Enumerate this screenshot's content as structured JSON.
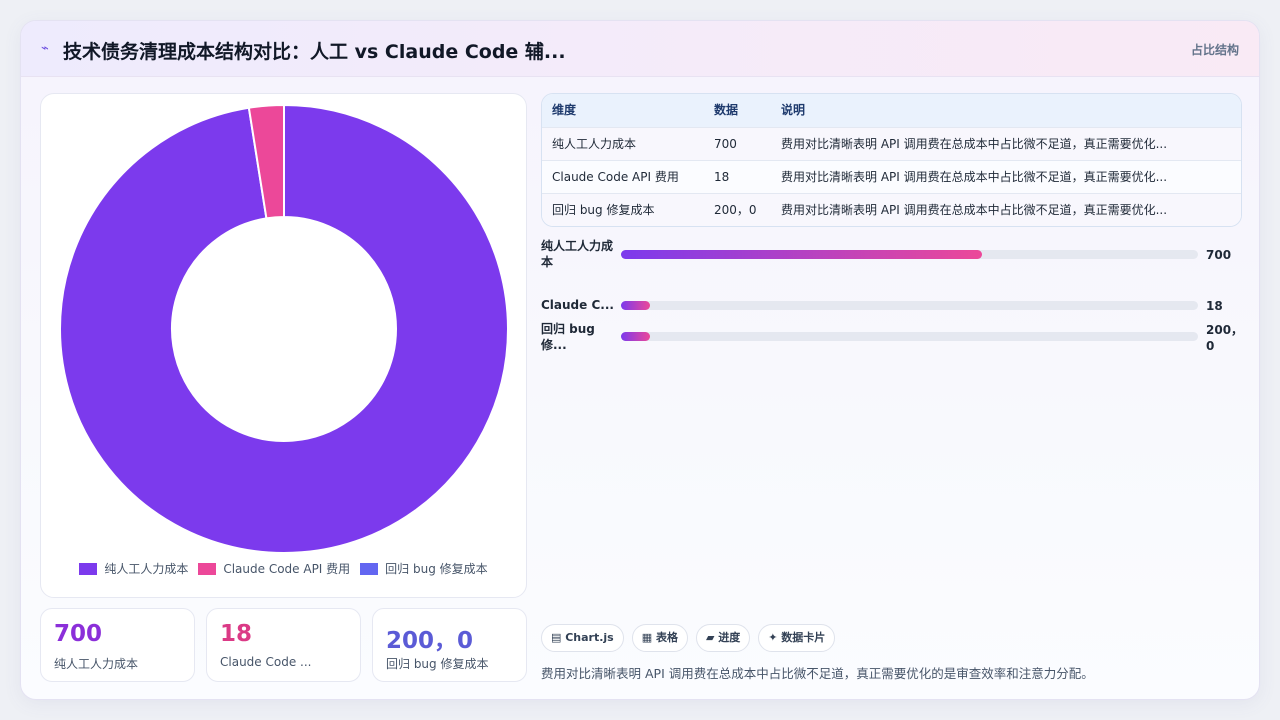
{
  "header": {
    "icon": "sparkle-icon",
    "icon_glyph": "⌁",
    "title": "技术债务清理成本结构对比：人工 vs Claude Code 辅...",
    "tag": "占比结构"
  },
  "chart_data": {
    "type": "pie",
    "categories": [
      "纯人工人力成本",
      "Claude Code API 费用",
      "回归 bug 修复成本"
    ],
    "values": [
      700,
      18,
      0
    ],
    "colors": [
      "#7c3aed",
      "#ec4899",
      "#6366f1"
    ],
    "title": "",
    "legend": "bottom",
    "donut": true
  },
  "stats": [
    {
      "value": "700",
      "label": "纯人工人力成本",
      "color": "#8b2fd9"
    },
    {
      "value": "18",
      "label": "Claude Code ...",
      "color": "#db3a86"
    },
    {
      "value": "200，0",
      "label": "回归 bug 修复成本",
      "color": "#5b5bd6"
    }
  ],
  "table": {
    "headers": [
      "维度",
      "数据",
      "说明"
    ],
    "rows": [
      [
        "纯人工人力成本",
        "700",
        "费用对比清晰表明 API 调用费在总成本中占比微不足道，真正需要优化..."
      ],
      [
        "Claude Code API 费用",
        "18",
        "费用对比清晰表明 API 调用费在总成本中占比微不足道，真正需要优化..."
      ],
      [
        "回归 bug 修复成本",
        "200，0",
        "费用对比清晰表明 API 调用费在总成本中占比微不足道，真正需要优化..."
      ]
    ]
  },
  "bars": [
    {
      "label": "纯人工人力成本",
      "value": "700",
      "fraction": 0.625
    },
    {
      "label": "Claude C...",
      "value": "18",
      "fraction": 0.05
    },
    {
      "label": "回归 bug 修...",
      "value": "200，0",
      "fraction": 0.05
    }
  ],
  "chips": [
    "▤ Chart.js",
    "▦ 表格",
    "▰ 进度",
    "✦ 数据卡片"
  ],
  "note": "费用对比清晰表明 API 调用费在总成本中占比微不足道，真正需要优化的是审查效率和注意力分配。"
}
